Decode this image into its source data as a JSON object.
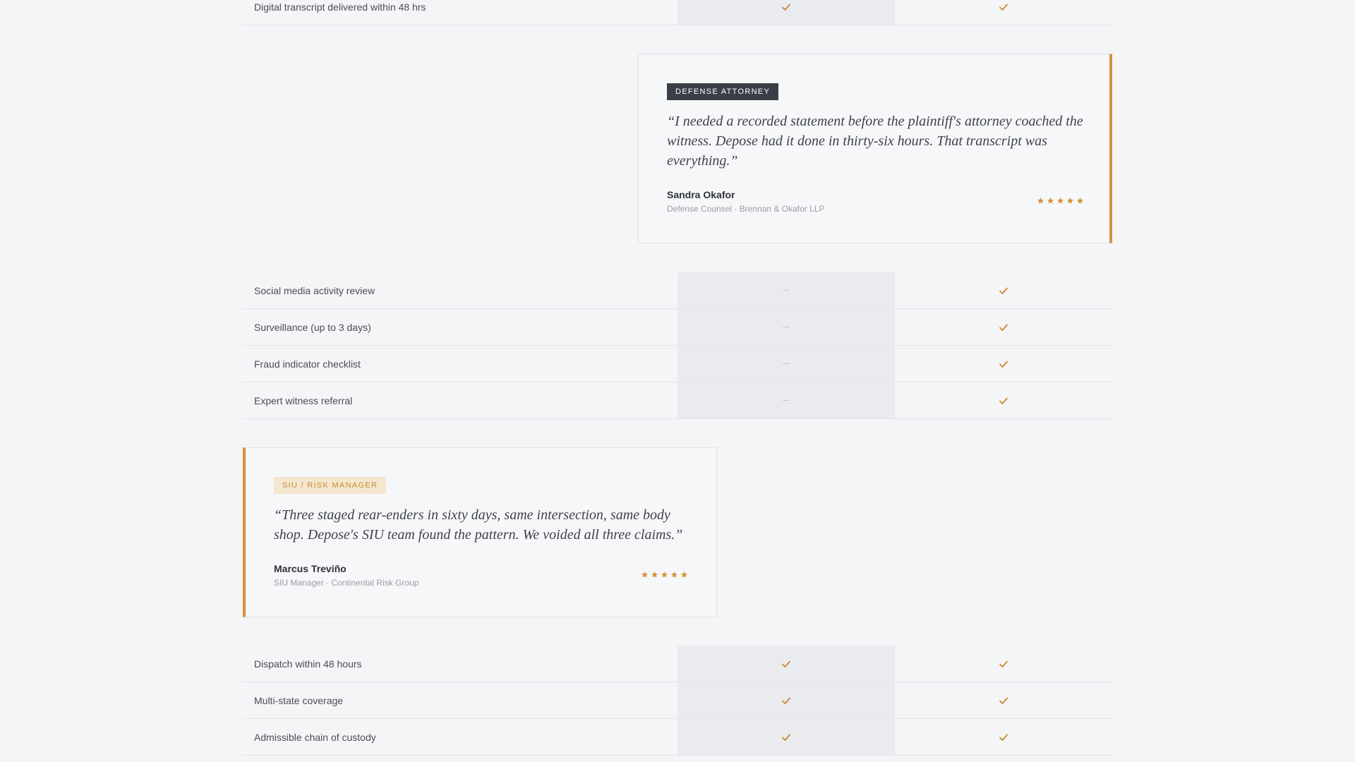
{
  "colors": {
    "accent": "#d4943a",
    "check": "#c98a2c",
    "dash": "#c4c7cc",
    "highlight_column": "#eaebee"
  },
  "icons": {
    "included": "check-icon",
    "excluded": "dash-icon",
    "rating": "star-icon"
  },
  "rows_top": [
    {
      "label": "Digital transcript delivered within 48 hrs",
      "marks": [
        "dash",
        "check",
        "check"
      ]
    }
  ],
  "testimonial_defense": {
    "badge": "Defense Attorney",
    "quote": "“I needed a recorded statement before the plaintiff's attorney coached the witness. Depose had it done in thirty-six hours. That transcript was everything.”",
    "author": "Sandra Okafor",
    "role": "Defense Counsel · Brennan & Okafor LLP",
    "rating": 5
  },
  "rows_group_a": [
    {
      "label": "Social media activity review",
      "marks": [
        "dash",
        "dash",
        "check"
      ]
    },
    {
      "label": "Surveillance (up to 3 days)",
      "marks": [
        "dash",
        "dash",
        "check"
      ]
    },
    {
      "label": "Fraud indicator checklist",
      "marks": [
        "dash",
        "dash",
        "check"
      ]
    },
    {
      "label": "Expert witness referral",
      "marks": [
        "dash",
        "dash",
        "check"
      ]
    }
  ],
  "testimonial_siu": {
    "badge": "SIU / Risk Manager",
    "quote": "“Three staged rear-enders in sixty days, same intersection, same body shop. Depose's SIU team found the pattern. We voided all three claims.”",
    "author": "Marcus Treviño",
    "role": "SIU Manager · Continental Risk Group",
    "rating": 5
  },
  "rows_group_b": [
    {
      "label": "Dispatch within 48 hours",
      "marks": [
        "check",
        "check",
        "check"
      ]
    },
    {
      "label": "Multi-state coverage",
      "marks": [
        "check",
        "check",
        "check"
      ]
    },
    {
      "label": "Admissible chain of custody",
      "marks": [
        "check",
        "check",
        "check"
      ]
    }
  ]
}
